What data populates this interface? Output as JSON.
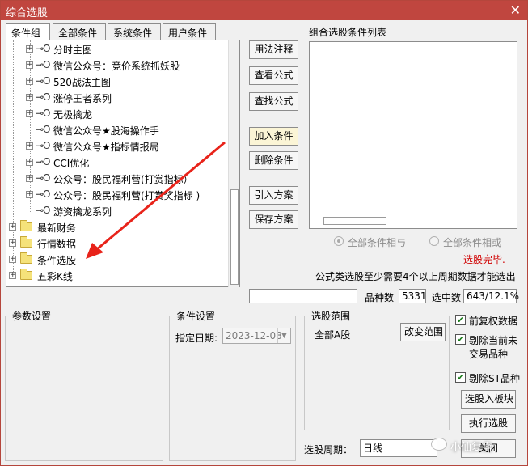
{
  "window": {
    "title": "综合选股",
    "accent": "#c0463f"
  },
  "tabs": [
    "条件组",
    "全部条件",
    "系统条件",
    "用户条件"
  ],
  "tree": {
    "items": [
      {
        "label": "分时主图",
        "type": "leaf",
        "expander": "+"
      },
      {
        "label": "微信公众号：竞价系统抓妖股",
        "type": "leaf",
        "expander": "+"
      },
      {
        "label": "520战法主图",
        "type": "leaf",
        "expander": "+"
      },
      {
        "label": "涨停王者系列",
        "type": "leaf",
        "expander": "+"
      },
      {
        "label": "无极擒龙",
        "type": "leaf",
        "expander": "+"
      },
      {
        "label": "微信公众号★股海操作手",
        "type": "leaf",
        "expander": ""
      },
      {
        "label": "微信公众号★指标情报局",
        "type": "leaf",
        "expander": "+"
      },
      {
        "label": "CCI优化",
        "type": "leaf",
        "expander": "+"
      },
      {
        "label": "公众号：股民福利营(打赏指标）",
        "type": "leaf",
        "expander": "+"
      },
      {
        "label": "公众号：股民福利营(打赏奖指标 )",
        "type": "leaf",
        "expander": "+"
      },
      {
        "label": "游资擒龙系列",
        "type": "leaf",
        "expander": ""
      },
      {
        "label": "最新财务",
        "type": "folder",
        "expander": "+"
      },
      {
        "label": "行情数据",
        "type": "folder",
        "expander": "+"
      },
      {
        "label": "条件选股",
        "type": "folder",
        "expander": "+"
      },
      {
        "label": "五彩K线",
        "type": "folder",
        "expander": "+"
      }
    ]
  },
  "buttons": {
    "usage_notes": "用法注释",
    "view_formula": "查看公式",
    "find_formula": "查找公式",
    "add_condition": "加入条件",
    "delete_condition": "删除条件",
    "import_plan": "引入方案",
    "save_plan": "保存方案",
    "change_range": "改变范围",
    "stocks_to_block": "选股入板块",
    "execute": "执行选股",
    "close": "关闭"
  },
  "combo": {
    "title": "组合选股条件列表",
    "radio_and": "全部条件相与",
    "radio_or": "全部条件相或",
    "status": "选股完毕.",
    "note": "公式类选股至少需要4个以上周期数据才能选出",
    "count_label": "品种数",
    "count_value": "5331",
    "selected_label": "选中数",
    "selected_value": "643/12.1%",
    "status_color": "#d00000"
  },
  "params": {
    "title": "参数设置"
  },
  "condition_settings": {
    "title": "条件设置",
    "date_label": "指定日期:",
    "date_value": "2023-12-08"
  },
  "range": {
    "title": "选股范围",
    "value": "全部A股"
  },
  "options": {
    "pre_adjusted": "前复权数据",
    "exclude_untraded": "剔除当前未交易品种",
    "exclude_untraded_line1": "剔除当前未",
    "exclude_untraded_line2": "交易品种",
    "exclude_st": "剔除ST品种"
  },
  "period": {
    "label": "选股周期：",
    "value": "日线"
  },
  "watermark": "小仙复盘"
}
